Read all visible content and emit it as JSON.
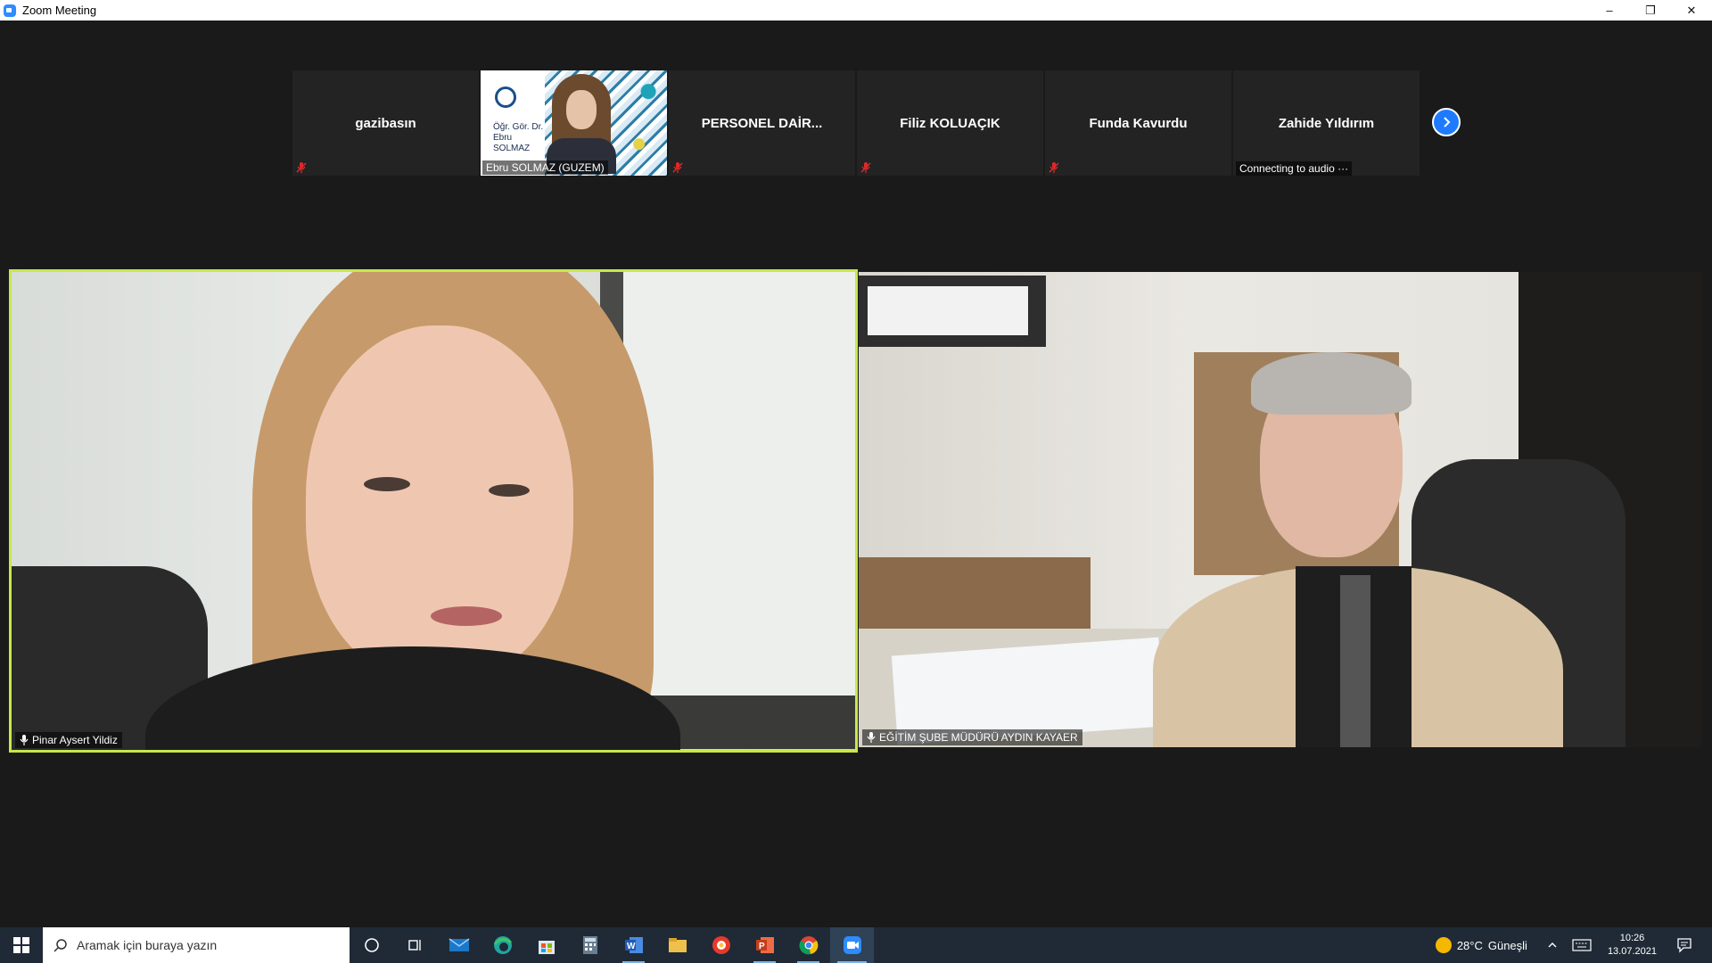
{
  "window": {
    "title": "Zoom Meeting",
    "controls": {
      "minimize": "–",
      "restore": "❐",
      "close": "✕"
    }
  },
  "thumbnails": [
    {
      "name": "gazibasın",
      "muted": true,
      "video": false
    },
    {
      "name": "Ebru SOLMAZ (GUZEM)",
      "muted": true,
      "video": true,
      "slide_text": [
        "Öğr. Gör. Dr.",
        "Ebru",
        "SOLMAZ"
      ]
    },
    {
      "name": "PERSONEL  DAİR...",
      "muted": true,
      "video": false
    },
    {
      "name": "Filiz KOLUAÇIK",
      "muted": true,
      "video": false
    },
    {
      "name": "Funda Kavurdu",
      "muted": true,
      "video": false
    },
    {
      "name": "Zahide Yıldırım",
      "muted": false,
      "video": false,
      "status": "Connecting to audio ···"
    }
  ],
  "main_tiles": [
    {
      "name": "Pinar Aysert Yildiz",
      "active_speaker": true
    },
    {
      "name": "EĞİTİM ŞUBE MÜDÜRÜ AYDIN KAYAER",
      "active_speaker": false
    }
  ],
  "taskbar": {
    "search_placeholder": "Aramak için buraya yazın",
    "apps": [
      "cortana-icon",
      "task-view-icon",
      "mail-icon",
      "edge-icon",
      "store-icon",
      "calculator-icon",
      "word-icon",
      "file-explorer-icon",
      "acrobat-icon",
      "powerpoint-icon",
      "chrome-icon",
      "zoom-icon"
    ],
    "active_app": "zoom-icon",
    "weather": {
      "temp": "28°C",
      "condition": "Güneşli"
    },
    "clock": {
      "time": "10:26",
      "date": "13.07.2021"
    }
  },
  "colors": {
    "accent": "#2d8cff",
    "active_speaker_border": "#c6e84a",
    "mute_red": "#e02828",
    "taskbar": "#1f2a36"
  }
}
